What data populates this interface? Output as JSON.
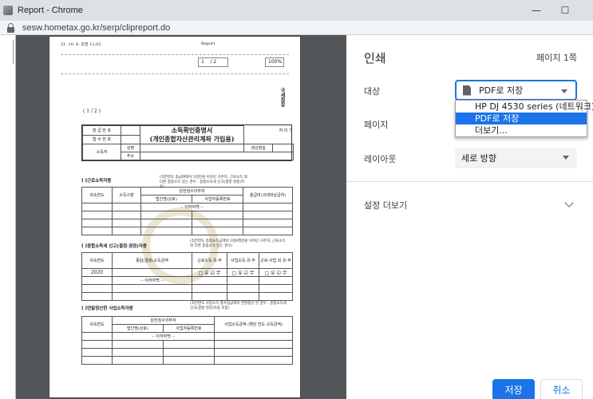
{
  "window": {
    "title": "Report - Chrome",
    "minimize_glyph": "—",
    "maximize_glyph": "☐",
    "url": "sesw.hometax.go.kr/serp/clipreport.do"
  },
  "preview": {
    "header_date": "21. 10. 6. 오전 11:02",
    "header_title": "Report",
    "page_field": "1",
    "page_total": "/ 2",
    "zoom": "100%",
    "page_indicator": "( 1 / 2 )",
    "seal_text": "국세청장",
    "doc": {
      "issue_no_label": "발 급 번 호",
      "receipt_no_label": "접 수 번 호",
      "processing_label": "처 리 기",
      "title_line1": "소득확인증명서",
      "title_line2": "(개인종합자산관리계좌 가입용)",
      "taxpayer_label": "소득자",
      "name_label": "성명",
      "address_label": "주소",
      "birth_label": "생년월일",
      "sec1_title": "[ ]근로소득자용",
      "sec1_note": "(직전연도 총급여액이 5천만원 이하인 거주자, 근로소득 외 다른 종합소득 있는 경우 : 종합소득세 신고(결정·경정)자용)",
      "col_year": "귀속연도",
      "col_type": "소득구분",
      "col_payer": "원천징수의무자",
      "col_corp": "법인명(상호)",
      "col_bizno": "사업자등록번호",
      "col_total": "총급여(과세대상급여)",
      "blank_below": "-- 이하여백 --",
      "sec2_title": "[ ]종합소득세 신고(결정·경정)자용",
      "sec2_note": "(직전연도 종합소득금액이 3천8백만원 이하인 거주자, 근로소득 외 다른 종합소득 있는 경우)",
      "col_income": "종합(결정)소득금액",
      "col_biz": "근로소득 유·무",
      "col_biz2": "사업소득 유·무",
      "col_other": "근로·사업 외 유·무",
      "year_2020": "2020",
      "checks": "□ 유 ☑ 무",
      "sec3_title": "[ ]연말정산한 사업소득자용",
      "sec3_note": "(직전연도 사업소득 총수입금액이 연말정산 된 경우 : 종합소득세 신고(결정·경정)자용 포함)",
      "col_biz_income": "사업소득금액 (해당 연도 소득금액)"
    }
  },
  "print": {
    "heading": "인쇄",
    "page_count": "페이지 1쪽",
    "destination_label": "대상",
    "destination_value": "PDF로 저장",
    "destination_options": [
      "HP DJ 4530 series (네트워크)",
      "PDF로 저장",
      "더보기..."
    ],
    "pages_label": "페이지",
    "layout_label": "레이아웃",
    "layout_value": "세로 방향",
    "more_settings": "설정 더보기",
    "save_button": "저장",
    "cancel_button": "취소"
  }
}
